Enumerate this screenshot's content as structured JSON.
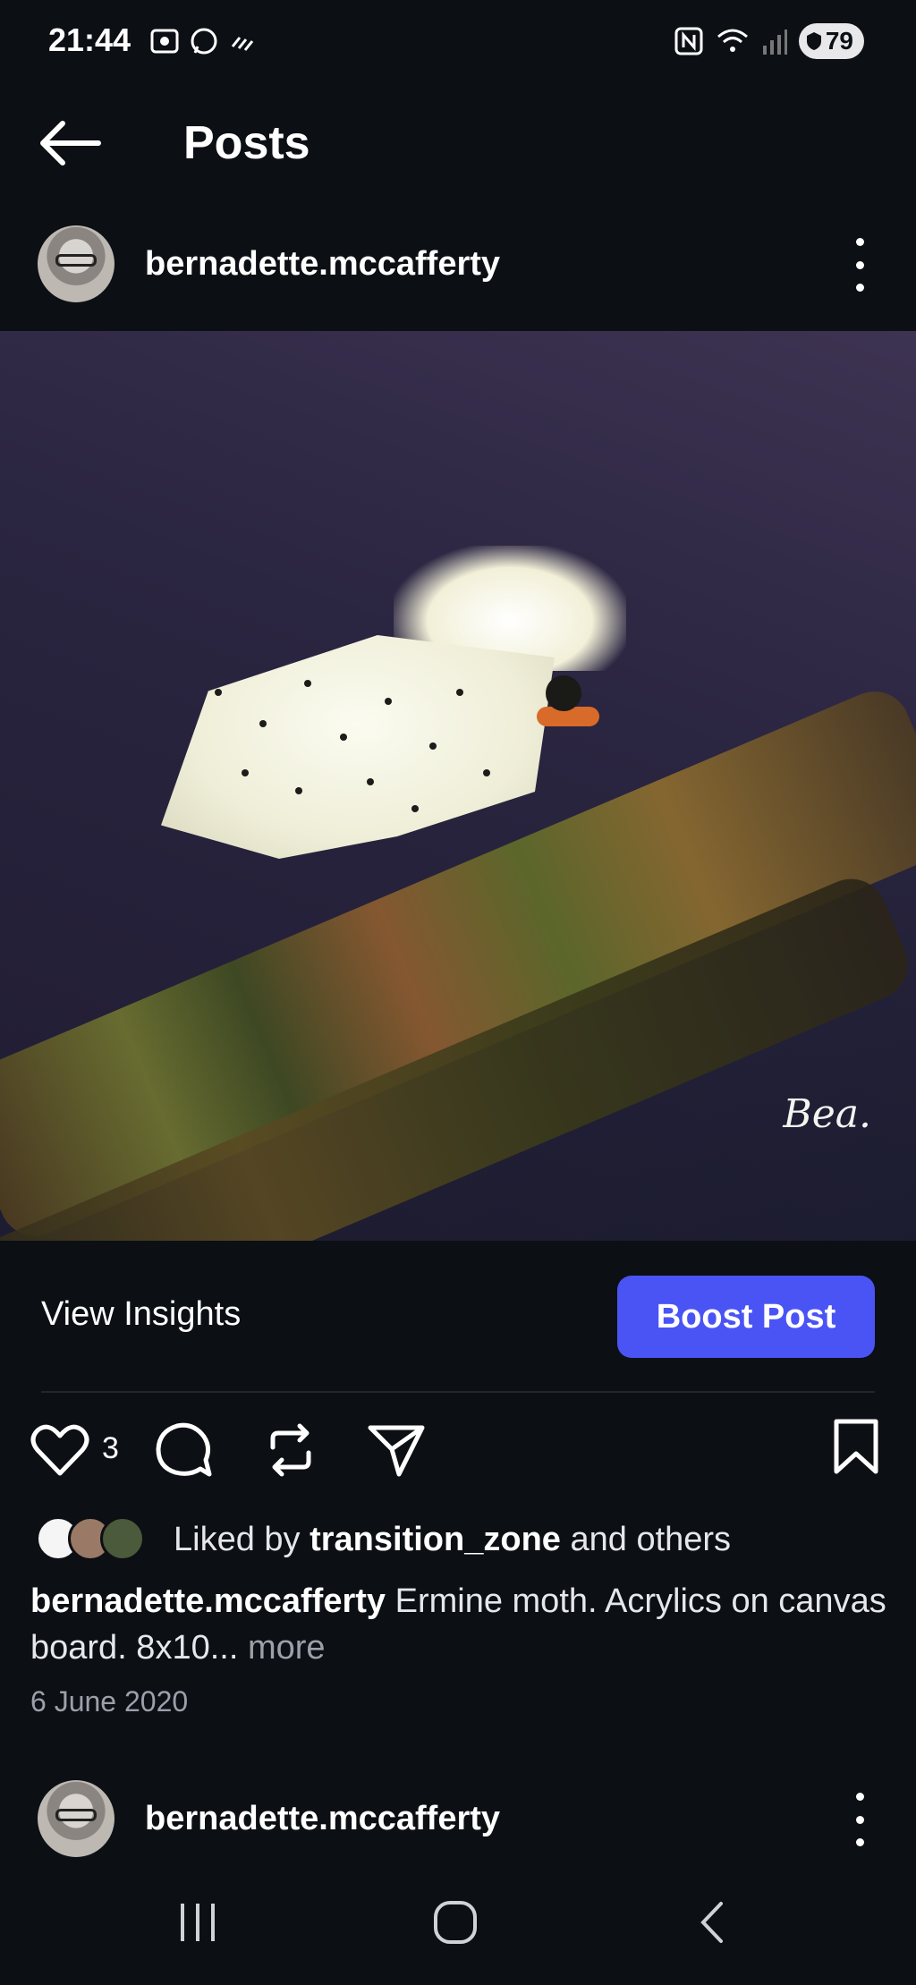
{
  "status_bar": {
    "time": "21:44",
    "battery": "79"
  },
  "header": {
    "title": "Posts"
  },
  "post": {
    "username": "bernadette.mccafferty",
    "signature": "Bea.",
    "view_insights_label": "View Insights",
    "boost_label": "Boost Post",
    "like_count": "3",
    "liked_by_prefix": "Liked by",
    "liked_by_user": "transition_zone",
    "liked_by_suffix": "and others",
    "caption_user": "bernadette.mccafferty",
    "caption_text": "Ermine moth. Acrylics on canvas board.  8x10...",
    "caption_more": "more",
    "date": "6 June 2020"
  },
  "next_post": {
    "username": "bernadette.mccafferty"
  },
  "colors": {
    "accent": "#4a54f4",
    "background": "#0c0f14"
  },
  "icons": [
    "back-arrow-icon",
    "heart-icon",
    "comment-icon",
    "repost-icon",
    "share-icon",
    "bookmark-icon",
    "more-icon"
  ]
}
